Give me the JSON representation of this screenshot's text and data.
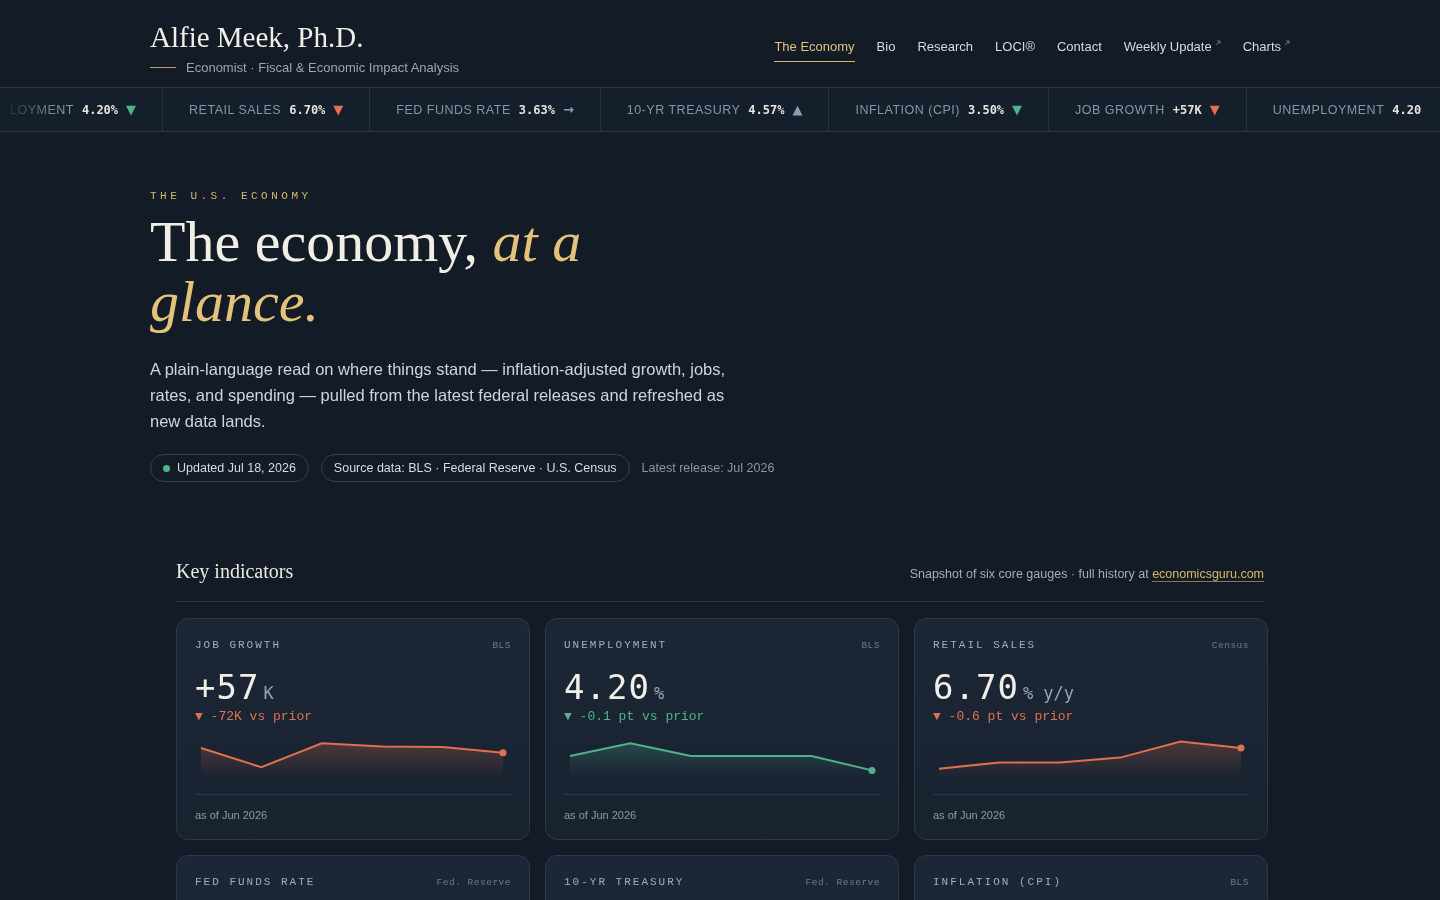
{
  "site": {
    "name": "Alfie Meek, Ph.D.",
    "tagline": "Economist · Fiscal & Economic Impact Analysis"
  },
  "nav": [
    {
      "label": "The Economy",
      "selected": true,
      "external": false
    },
    {
      "label": "Bio",
      "selected": false,
      "external": false
    },
    {
      "label": "Research",
      "selected": false,
      "external": false
    },
    {
      "label": "LOCI®",
      "selected": false,
      "external": false
    },
    {
      "label": "Contact",
      "selected": false,
      "external": false
    },
    {
      "label": "Weekly Update",
      "selected": false,
      "external": true
    },
    {
      "label": "Charts",
      "selected": false,
      "external": true
    }
  ],
  "ticker": [
    {
      "label": "LOYMENT",
      "value": "4.20%",
      "arrow": "▼",
      "color": "#4fb38a"
    },
    {
      "label": "RETAIL SALES",
      "value": "6.70%",
      "arrow": "▼",
      "color": "#e0704f"
    },
    {
      "label": "FED FUNDS RATE",
      "value": "3.63%",
      "arrow": "→",
      "color": "#8f9bb0"
    },
    {
      "label": "10-YR TREASURY",
      "value": "4.57%",
      "arrow": "▲",
      "color": "#8f9bb0"
    },
    {
      "label": "INFLATION (CPI)",
      "value": "3.50%",
      "arrow": "▼",
      "color": "#4fb38a"
    },
    {
      "label": "JOB GROWTH",
      "value": "+57K",
      "arrow": "▼",
      "color": "#e0704f"
    },
    {
      "label": "UNEMPLOYMENT",
      "value": "4.20"
    }
  ],
  "hero": {
    "eyebrow": "THE U.S. ECONOMY",
    "title": "The economy,",
    "title_accent": "at a glance.",
    "lead": "A plain-language read on where things stand — inflation-adjusted growth, jobs, rates, and spending — pulled from the latest federal releases and refreshed as new data lands.",
    "chips": [
      {
        "label": "Updated Jul 18, 2026",
        "dot": true
      },
      {
        "label": "Source data: BLS · Federal Reserve · U.S. Census",
        "dot": false
      }
    ],
    "note": "Latest release: Jul 2026"
  },
  "indicators": {
    "title": "Key indicators",
    "note": "Snapshot of six core gauges · full history at",
    "link": "economicsguru.com",
    "cards": [
      {
        "name": "JOB GROWTH",
        "source": "BLS",
        "value": "+57",
        "unit": "K",
        "change": "▼ -72K vs prior",
        "color": "#e0704f",
        "asof": "as of Jun 2026"
      },
      {
        "name": "UNEMPLOYMENT",
        "source": "BLS",
        "value": "4.20",
        "unit": "%",
        "change": "▼ -0.1 pt vs prior",
        "color": "#4fb38a",
        "asof": "as of Jun 2026"
      },
      {
        "name": "RETAIL SALES",
        "source": "Census",
        "value": "6.70",
        "unit": "% y/y",
        "change": "▼ -0.6 pt vs prior",
        "color": "#e0704f",
        "asof": "as of Jun 2026"
      },
      {
        "name": "FED FUNDS RATE",
        "source": "Fed. Reserve"
      },
      {
        "name": "10-YR TREASURY",
        "source": "Fed. Reserve"
      },
      {
        "name": "INFLATION (CPI)",
        "source": "BLS"
      }
    ]
  }
}
